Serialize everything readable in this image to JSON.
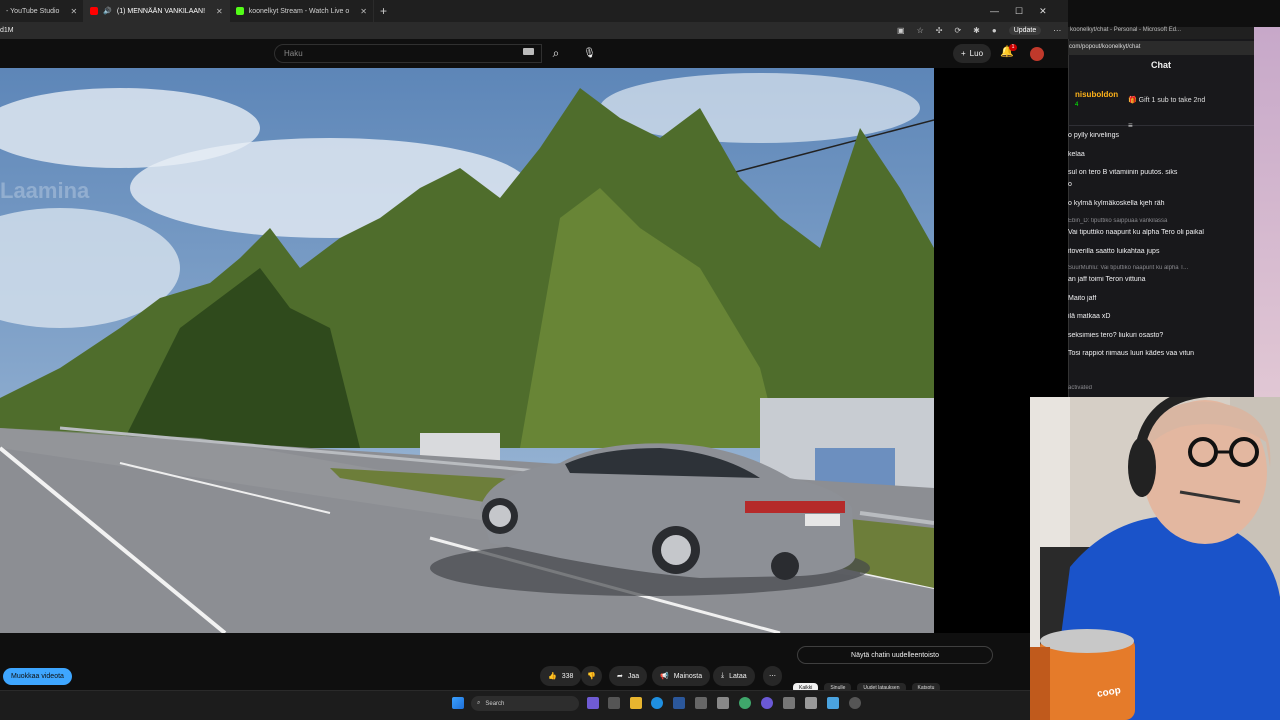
{
  "browser": {
    "tabs": [
      {
        "label": "- YouTube Studio",
        "active": false
      },
      {
        "label": "(1) MENNÄÄN VANKILAAN!",
        "active": true
      },
      {
        "label": "koonelkyt Stream - Watch Live o",
        "active": false
      }
    ],
    "address": "d1M",
    "update_label": "Update"
  },
  "youtube": {
    "search_placeholder": "Haku",
    "create_label": "Luo",
    "notification_count": "1",
    "actions": {
      "like_count": "338",
      "share_label": "Jaa",
      "promote_label": "Mainosta",
      "download_label": "Lataa"
    },
    "edit_video_label": "Muokkaa videota",
    "rechat_label": "Näytä chatin uudelleentoisto",
    "chips": [
      "Kaikki",
      "Sinulle",
      "Uudet latauksen",
      "Katsotu"
    ],
    "watermark": "Laamina"
  },
  "chat_window": {
    "title": "koonelkyt/chat - Personal - Microsoft Ed...",
    "url": "com/popout/koonelkyt/chat",
    "heading": "Chat",
    "pinned_user": "nisuboldon",
    "pinned_count": "4",
    "gift_text": "Gift 1 sub to take 2nd",
    "messages": [
      {
        "text": "o pylly kirvelings",
        "reply": false
      },
      {
        "text": "kelaa",
        "reply": false
      },
      {
        "text": "sul on tero B vitamiinin puutos. siks",
        "reply": false
      },
      {
        "text": "o",
        "reply": false
      },
      {
        "text": "o kylmä kylmäkoskella kjeh räh",
        "reply": false
      },
      {
        "text": "Ebin_D: tiputtiko saippuaa vankilassa",
        "reply": true
      },
      {
        "text": "Vai tiputtiko naapurit ku alpha Tero oli paikal",
        "reply": false
      },
      {
        "text": "itoverilla saatto luikahtaa jups",
        "reply": false
      },
      {
        "text": "SuurMuhlu: Vai tiputtiko naapurit ku alpha T...",
        "reply": true
      },
      {
        "text": "an jaff toimi Teron vittuna",
        "reply": false
      },
      {
        "text": "Maito jaff",
        "reply": false
      },
      {
        "text": "ilä matkaa xD",
        "reply": false
      },
      {
        "text": "seksimies tero? liukuri osasto?",
        "reply": false
      },
      {
        "text": "Tosi rappiot riimaus luuri kädes vaa vitun",
        "reply": false
      },
      {
        "text": "activated",
        "reply": true
      }
    ]
  },
  "taskbar": {
    "search_placeholder": "Search"
  },
  "webcam": {
    "can_label": "coop"
  },
  "colors": {
    "accent_blue": "#3ea6ff",
    "youtube_red": "#ff0000",
    "chat_bg": "#18181b",
    "pinned_user_color": "#ffb31a"
  }
}
